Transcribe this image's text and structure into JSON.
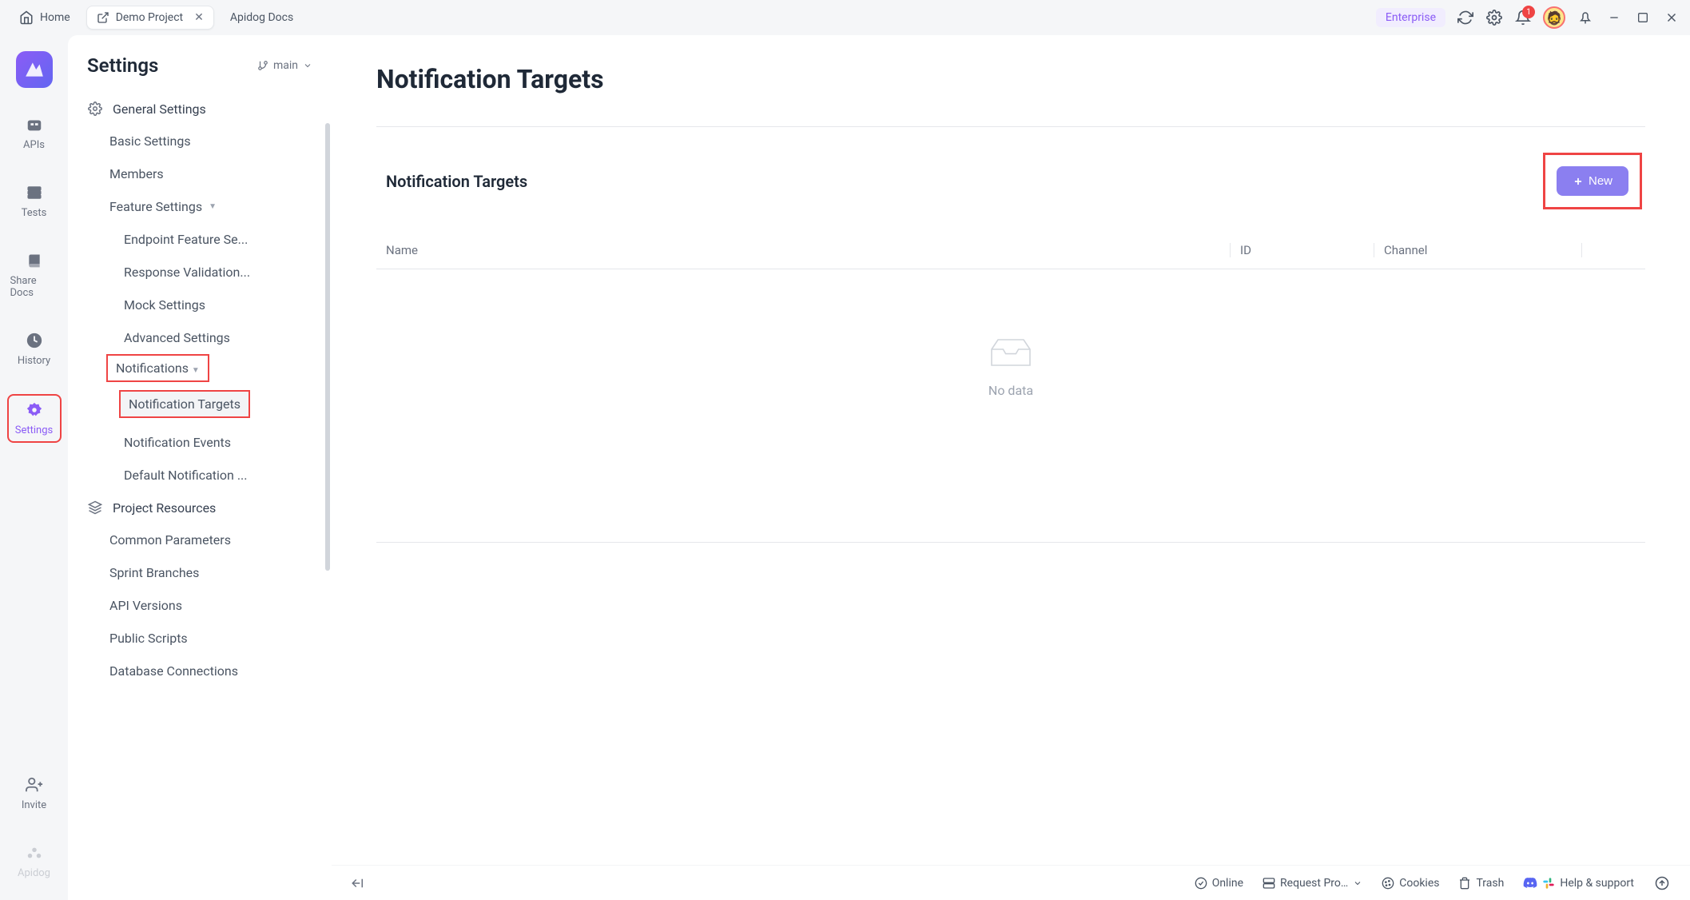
{
  "tabs": {
    "home": "Home",
    "project": "Demo Project",
    "docs": "Apidog Docs"
  },
  "header": {
    "enterprise": "Enterprise",
    "notif_count": "1"
  },
  "rail": {
    "apis": "APIs",
    "tests": "Tests",
    "share_docs": "Share Docs",
    "history": "History",
    "settings": "Settings",
    "invite": "Invite",
    "apidog": "Apidog"
  },
  "sidebar": {
    "title": "Settings",
    "branch": "main",
    "sections": {
      "general": "General Settings",
      "project_resources": "Project Resources"
    },
    "items": {
      "basic_settings": "Basic Settings",
      "members": "Members",
      "feature_settings": "Feature Settings",
      "endpoint_feature": "Endpoint Feature Se...",
      "response_validation": "Response Validation...",
      "mock_settings": "Mock Settings",
      "advanced_settings": "Advanced Settings",
      "notifications": "Notifications",
      "notification_targets": "Notification Targets",
      "notification_events": "Notification Events",
      "default_notification": "Default Notification ...",
      "common_parameters": "Common Parameters",
      "sprint_branches": "Sprint Branches",
      "api_versions": "API Versions",
      "public_scripts": "Public Scripts",
      "database_connections": "Database Connections"
    }
  },
  "content": {
    "page_title": "Notification Targets",
    "section_title": "Notification Targets",
    "new_button": "New",
    "table": {
      "col_name": "Name",
      "col_id": "ID",
      "col_channel": "Channel"
    },
    "empty_text": "No data"
  },
  "status": {
    "online": "Online",
    "request_proxy": "Request Pro…",
    "cookies": "Cookies",
    "trash": "Trash",
    "help": "Help & support"
  }
}
